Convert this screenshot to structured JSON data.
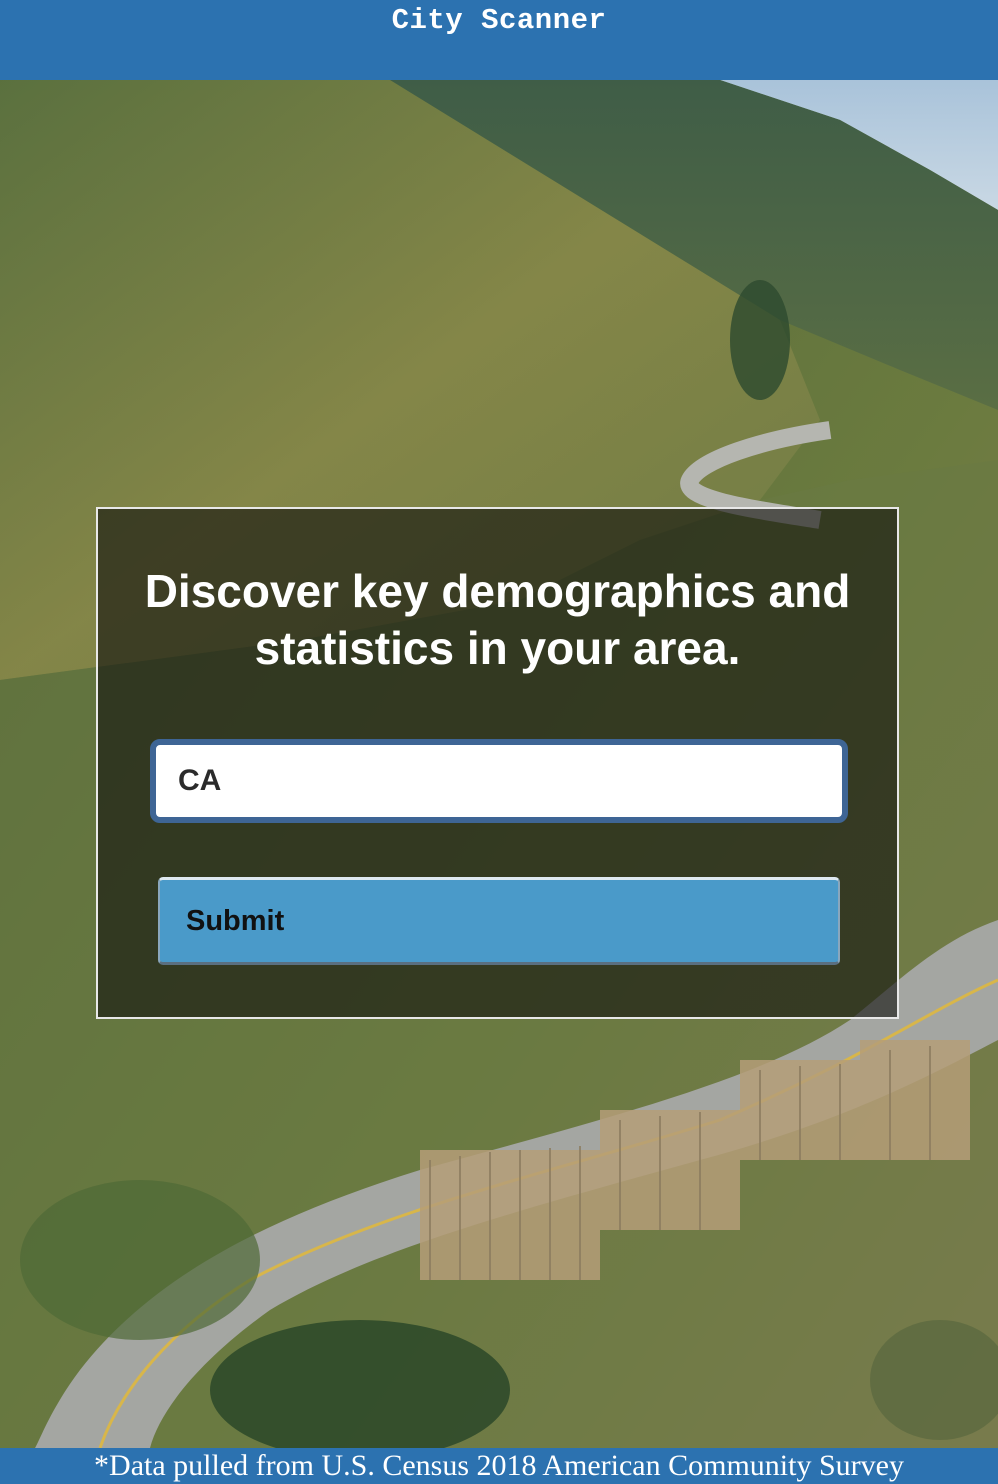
{
  "header": {
    "title": "City Scanner"
  },
  "background": {
    "description_icon": "landscape-photo"
  },
  "search_card": {
    "heading": "Discover key demographics and statistics in your area.",
    "input_value": "CA",
    "submit_label": "Submit"
  },
  "footer": {
    "note": "*Data pulled from U.S. Census 2018 American Community Survey"
  },
  "colors": {
    "header_bg": "#2c72b0",
    "button_bg": "#4a9ac9",
    "input_border": "#3e6595",
    "card_overlay": "rgba(20, 20, 15, 0.62)"
  }
}
